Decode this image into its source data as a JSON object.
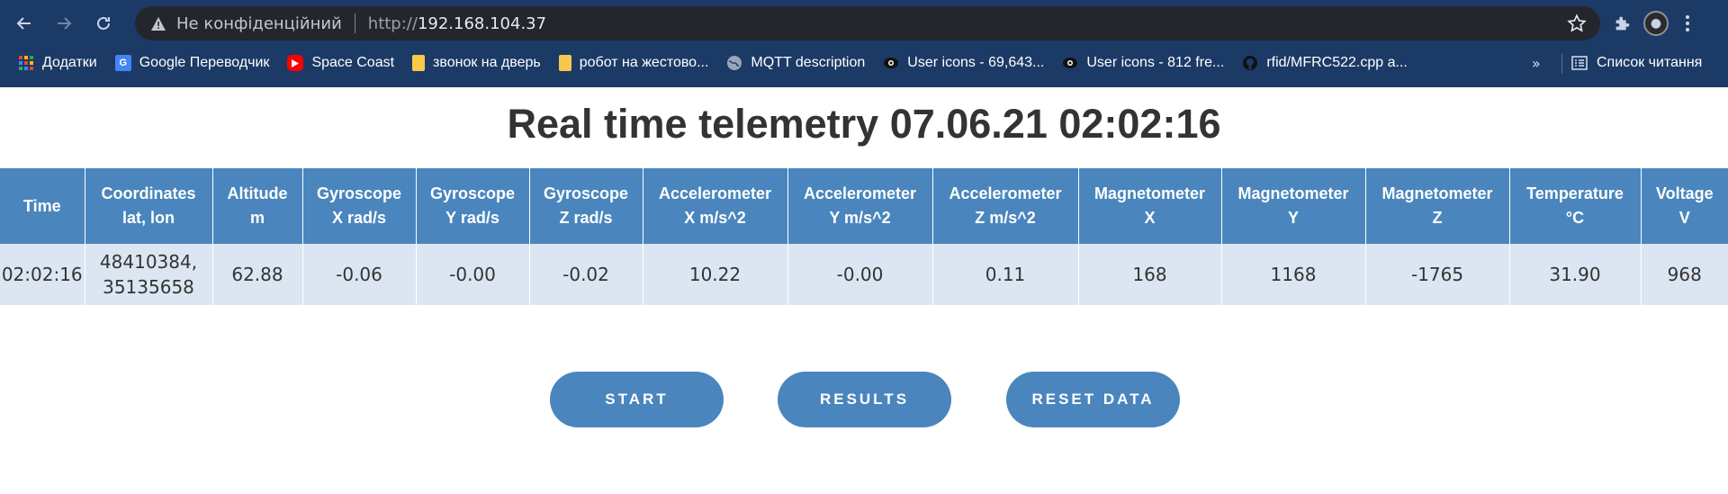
{
  "browser": {
    "security_label": "Не конфіденційний",
    "url_scheme": "http://",
    "url_host": "192.168.104.37",
    "bookmarks": [
      {
        "label": "Додатки",
        "icon": "apps-grid-icon"
      },
      {
        "label": "Google Переводчик",
        "icon": "google-translate-icon"
      },
      {
        "label": "Space Coast",
        "icon": "youtube-icon"
      },
      {
        "label": "звонок на дверь",
        "icon": "note-icon"
      },
      {
        "label": "робот на жестово...",
        "icon": "note-icon"
      },
      {
        "label": "MQTT description",
        "icon": "globe-icon"
      },
      {
        "label": "User icons - 69,643...",
        "icon": "icons8-icon"
      },
      {
        "label": "User icons - 812 fre...",
        "icon": "icons8-icon"
      },
      {
        "label": "rfid/MFRC522.cpp a...",
        "icon": "github-icon"
      }
    ],
    "more_label": "»",
    "reading_list_label": "Список читання"
  },
  "page": {
    "title": "Real time telemetry 07.06.21 02:02:16"
  },
  "table": {
    "headers": [
      [
        "Time"
      ],
      [
        "Coordinates",
        "lat, lon"
      ],
      [
        "Altitude",
        "m"
      ],
      [
        "Gyroscope",
        "X rad/s"
      ],
      [
        "Gyroscope",
        "Y rad/s"
      ],
      [
        "Gyroscope",
        "Z rad/s"
      ],
      [
        "Accelerometer",
        "X m/s^2"
      ],
      [
        "Accelerometer",
        "Y m/s^2"
      ],
      [
        "Accelerometer",
        "Z m/s^2"
      ],
      [
        "Magnetometer",
        "X"
      ],
      [
        "Magnetometer",
        "Y"
      ],
      [
        "Magnetometer",
        "Z"
      ],
      [
        "Temperature",
        "°C"
      ],
      [
        "Voltage",
        "V"
      ]
    ],
    "row": [
      [
        "02:02:16"
      ],
      [
        "48410384,",
        "35135658"
      ],
      [
        "62.88"
      ],
      [
        "-0.06"
      ],
      [
        "-0.00"
      ],
      [
        "-0.02"
      ],
      [
        "10.22"
      ],
      [
        "-0.00"
      ],
      [
        "0.11"
      ],
      [
        "168"
      ],
      [
        "1168"
      ],
      [
        "-1765"
      ],
      [
        "31.90"
      ],
      [
        "968"
      ]
    ]
  },
  "buttons": {
    "start": "START",
    "results": "RESULTS",
    "reset": "RESET DATA"
  },
  "colors": {
    "accent": "#4a86bd",
    "row_bg": "#dbe6f2",
    "chrome_bg": "#1c3a66"
  }
}
